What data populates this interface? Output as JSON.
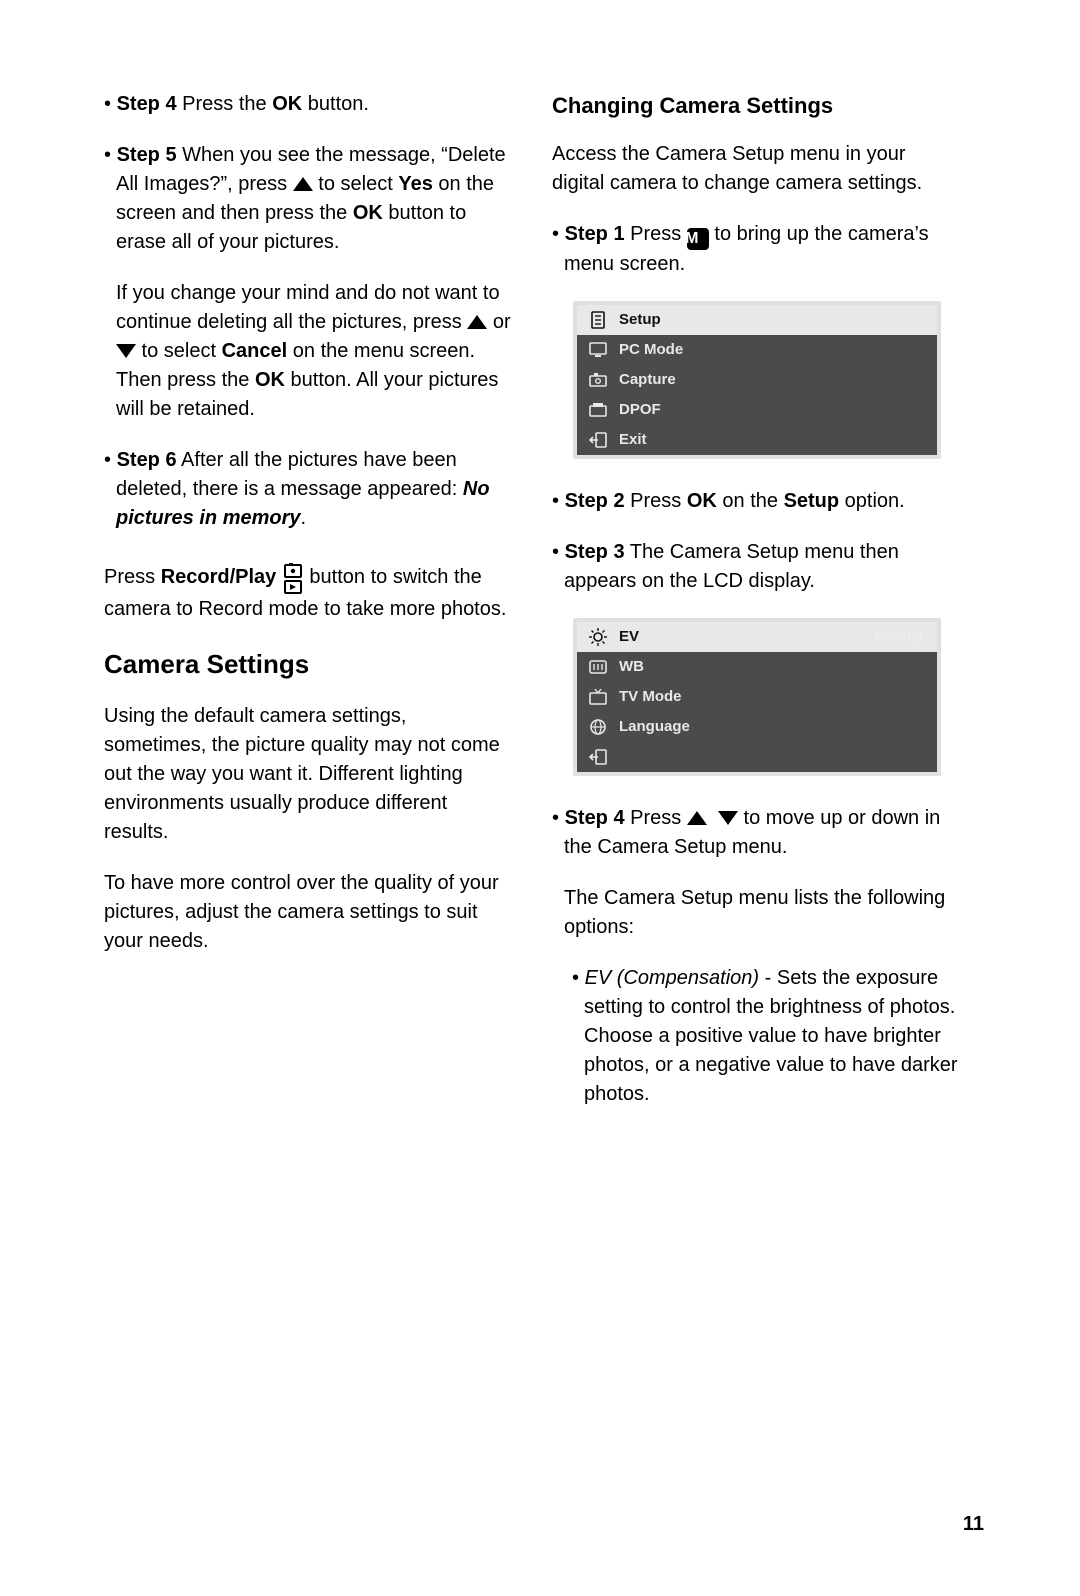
{
  "left": {
    "step4": {
      "label": "Step 4",
      "text": " Press the ",
      "ok": "OK",
      "text2": " button."
    },
    "step5": {
      "label": "Step 5",
      "t1": " When you see the message, “Delete All Images?”, press ",
      "t2": " to select ",
      "yes": "Yes",
      "t3": " on the screen and then press the ",
      "ok": "OK",
      "t4": " button to erase all of your pictures."
    },
    "cancel": {
      "t1": "If you change your mind and do not want to continue deleting all the pictures, press ",
      "t2": " or ",
      "t3": " to select ",
      "cancel": "Cancel",
      "t4": " on the menu screen. Then press the ",
      "ok": "OK",
      "t5": " button. All your pictures will be retained."
    },
    "step6": {
      "label": "Step 6",
      "t1": "  After all the pictures have been deleted, there is a message appeared: ",
      "msg": "No pictures in memory",
      "dot": "."
    },
    "recplay": {
      "t1": "Press ",
      "rp": "Record/Play",
      "t2": "  button to switch the camera to Record mode to take more photos."
    },
    "h2": "Camera Settings",
    "p1": "Using the default camera settings, sometimes, the picture quality may not come out the way you want it. Different lighting environments usually produce different results.",
    "p2": "To have more control over the quality of your pictures, adjust the camera settings to suit your needs."
  },
  "right": {
    "h3": "Changing Camera Settings",
    "intro": "Access the Camera Setup menu in your digital camera to change camera settings.",
    "step1": {
      "label": "Step 1",
      "t1": " Press ",
      "t2": " to bring up the camera’s menu screen."
    },
    "menu1": {
      "items": [
        {
          "icon": "page",
          "label": "Setup",
          "selected": true
        },
        {
          "icon": "monitor",
          "label": "PC Mode"
        },
        {
          "icon": "camera",
          "label": "Capture"
        },
        {
          "icon": "dpof",
          "label": "DPOF"
        },
        {
          "icon": "exit",
          "label": "Exit"
        }
      ]
    },
    "step2": {
      "label": "Step 2",
      "t1": " Press ",
      "ok": "OK",
      "t2": " on the ",
      "setup": "Setup",
      "t3": " option."
    },
    "step3": {
      "label": "Step 3",
      "t1": " The Camera Setup menu then appears on the LCD display."
    },
    "menu2": {
      "items": [
        {
          "icon": "ev",
          "label": "EV",
          "value": "Normal",
          "selected": true
        },
        {
          "icon": "wb",
          "label": "WB"
        },
        {
          "icon": "tv",
          "label": "TV Mode"
        },
        {
          "icon": "lang",
          "label": "Language"
        },
        {
          "icon": "exit",
          "label": ""
        }
      ]
    },
    "step4": {
      "label": "Step 4",
      "t1": " Press ",
      "t2": "  to move up or down in the Camera Setup menu."
    },
    "listintro": "The Camera Setup menu lists the following options:",
    "ev": {
      "name": "EV (Compensation)",
      "desc": " - Sets the exposure setting to control the brightness of photos. Choose a positive value to have brighter photos, or a negative value to have darker photos."
    }
  },
  "pagenum": "11"
}
